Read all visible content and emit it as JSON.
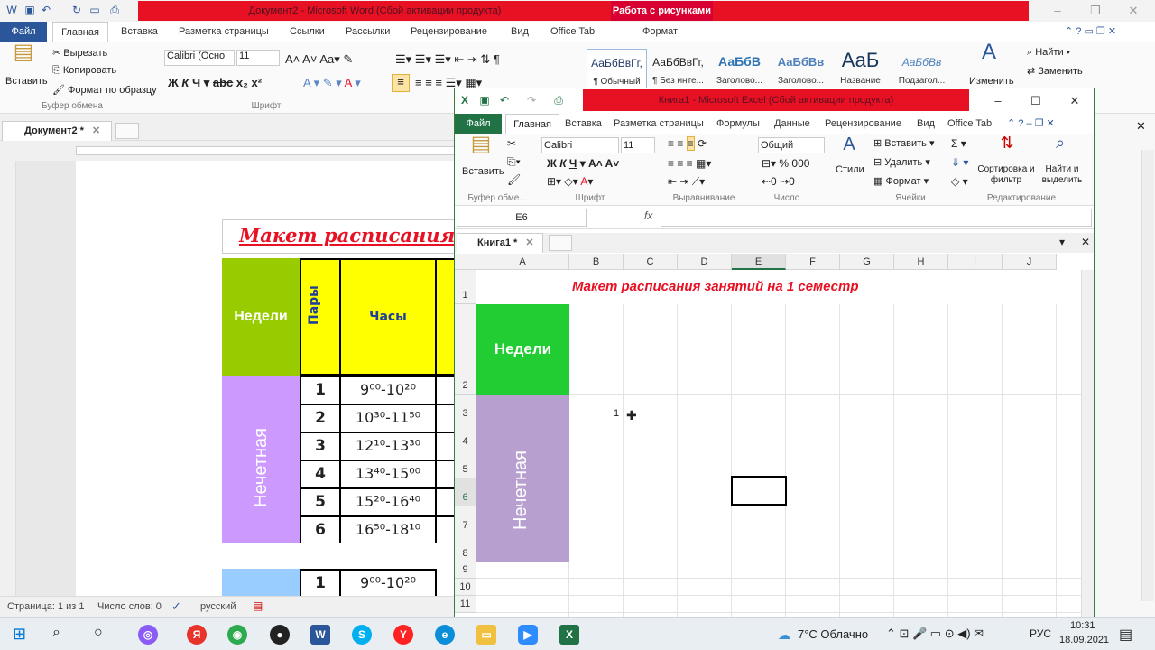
{
  "word": {
    "title": "Документ2 - Microsoft Word (Сбой активации продукта)",
    "contextual_tab": "Работа с рисунками",
    "tabs": [
      "Файл",
      "Главная",
      "Вставка",
      "Разметка страницы",
      "Ссылки",
      "Рассылки",
      "Рецензирование",
      "Вид",
      "Office Tab",
      "Формат"
    ],
    "clipboard": {
      "paste": "Вставить",
      "cut": "Вырезать",
      "copy": "Копировать",
      "format_painter": "Формат по образцу",
      "group": "Буфер обмена"
    },
    "font": {
      "name": "Calibri (Осно",
      "size": "11",
      "group": "Шрифт"
    },
    "styles": [
      {
        "preview": "АаБбВвГг,",
        "name": "¶ Обычный"
      },
      {
        "preview": "АаБбВвГг,",
        "name": "¶ Без инте..."
      },
      {
        "preview": "АаБбВ",
        "name": "Заголово..."
      },
      {
        "preview": "АаБбВв",
        "name": "Заголово..."
      },
      {
        "preview": "АаБ",
        "name": "Название"
      },
      {
        "preview": "АаБбВв",
        "name": "Подзагол..."
      }
    ],
    "editing": {
      "find": "Найти",
      "replace": "Заменить",
      "change": "Изменить"
    },
    "doc_tab": "Документ2 *",
    "table_title": "Макет расписания",
    "header_weeks": "Недели",
    "header_pairs": "Пары",
    "header_hours": "Часы",
    "odd_week": "Нечетная",
    "rows": [
      {
        "n": "1",
        "t": "9⁰⁰-10²⁰"
      },
      {
        "n": "2",
        "t": "10³⁰-11⁵⁰"
      },
      {
        "n": "3",
        "t": "12¹⁰-13³⁰"
      },
      {
        "n": "4",
        "t": "13⁴⁰-15⁰⁰"
      },
      {
        "n": "5",
        "t": "15²⁰-16⁴⁰"
      },
      {
        "n": "6",
        "t": "16⁵⁰-18¹⁰"
      }
    ],
    "next_row": {
      "n": "1",
      "t": "9⁰⁰-10²⁰"
    },
    "status": {
      "page": "Страница: 1 из 1",
      "words": "Число слов: 0",
      "lang": "русский"
    }
  },
  "excel": {
    "title": "Книга1 - Microsoft Excel (Сбой активации продукта)",
    "tabs": [
      "Файл",
      "Главная",
      "Вставка",
      "Разметка страницы",
      "Формулы",
      "Данные",
      "Рецензирование",
      "Вид",
      "Office Tab"
    ],
    "ribbon": {
      "paste": "Вставить",
      "clipboard_group": "Буфер обме...",
      "font_name": "Calibri",
      "font_size": "11",
      "font_group": "Шрифт",
      "align_group": "Выравнивание",
      "number_format": "Общий",
      "number_group": "Число",
      "styles": "Стили",
      "insert": "Вставить",
      "delete": "Удалить",
      "format": "Формат",
      "cells_group": "Ячейки",
      "sort": "Сортировка и фильтр",
      "find": "Найти и выделить",
      "edit_group": "Редактирование"
    },
    "name_box": "E6",
    "doc_tab": "Книга1 *",
    "columns": [
      "A",
      "B",
      "C",
      "D",
      "E",
      "F",
      "G",
      "H",
      "I",
      "J"
    ],
    "rows": [
      "1",
      "2",
      "3",
      "4",
      "5",
      "6",
      "7",
      "8",
      "9",
      "10",
      "11"
    ],
    "sheet_title": "Макет расписания занятий на 1 семестр",
    "weeks": "Недели",
    "odd": "Нечетная",
    "cell_b3": "1"
  },
  "taskbar": {
    "weather": "7°C  Облачно",
    "lang": "РУС",
    "time": "10:31",
    "date": "18.09.2021"
  }
}
